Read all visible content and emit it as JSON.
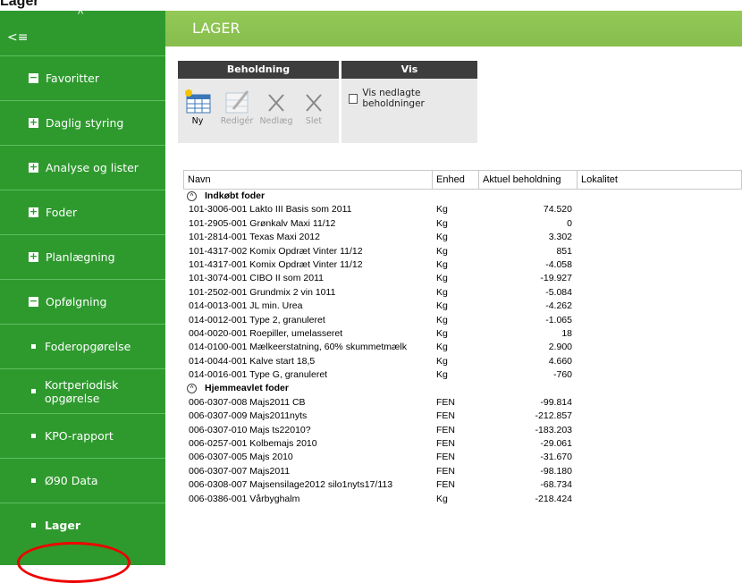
{
  "caption": "Lager",
  "sidebar": {
    "items": [
      {
        "label": "Favoritter",
        "kind": "box",
        "marker": "−"
      },
      {
        "label": "Daglig styring",
        "kind": "box",
        "marker": "+"
      },
      {
        "label": "Analyse og lister",
        "kind": "box",
        "marker": "+"
      },
      {
        "label": "Foder",
        "kind": "box",
        "marker": "+"
      },
      {
        "label": "Planlægning",
        "kind": "box",
        "marker": "+"
      },
      {
        "label": "Opfølgning",
        "kind": "box",
        "marker": "−"
      },
      {
        "label": "Foderopgørelse",
        "kind": "bullet"
      },
      {
        "label": "Kortperiodisk opgørelse",
        "kind": "bullet"
      },
      {
        "label": "KPO-rapport",
        "kind": "bullet"
      },
      {
        "label": "Ø90 Data",
        "kind": "bullet"
      },
      {
        "label": "Lager",
        "kind": "bullet",
        "bold": true
      }
    ]
  },
  "header": {
    "title": "LAGER"
  },
  "ribbon": {
    "beholdning": {
      "title": "Beholdning",
      "buttons": [
        {
          "label": "Ny",
          "icon": "new-table-icon",
          "enabled": true
        },
        {
          "label": "Redigér",
          "icon": "edit-icon",
          "enabled": false
        },
        {
          "label": "Nedlæg",
          "icon": "x-icon",
          "enabled": false
        },
        {
          "label": "Slet",
          "icon": "x-icon",
          "enabled": false
        }
      ]
    },
    "vis": {
      "title": "Vis",
      "checkbox_label": "Vis nedlagte beholdninger",
      "checked": false
    }
  },
  "table": {
    "columns": [
      "Navn",
      "Enhed",
      "Aktuel beholdning",
      "Lokalitet"
    ],
    "groups": [
      {
        "name": "Indkøbt foder",
        "rows": [
          [
            "101-3006-001 Lakto III Basis som 2011",
            "Kg",
            "74.520"
          ],
          [
            "101-2905-001 Grønkalv Maxi 11/12",
            "Kg",
            "0"
          ],
          [
            "101-2814-001 Texas Maxi 2012",
            "Kg",
            "3.302"
          ],
          [
            "101-4317-002 Komix Opdræt Vinter 11/12",
            "Kg",
            "851"
          ],
          [
            "101-4317-001 Komix Opdræt Vinter 11/12",
            "Kg",
            "-4.058"
          ],
          [
            "101-3074-001 CIBO II som 2011",
            "Kg",
            "-19.927"
          ],
          [
            "101-2502-001 Grundmix 2 vin 1011",
            "Kg",
            "-5.084"
          ],
          [
            "014-0013-001 JL min. Urea",
            "Kg",
            "-4.262"
          ],
          [
            "014-0012-001 Type 2, granuleret",
            "Kg",
            "-1.065"
          ],
          [
            "004-0020-001 Roepiller, umelasseret",
            "Kg",
            "18"
          ],
          [
            "014-0100-001 Mælkeerstatning, 60% skummetmælk",
            "Kg",
            "2.900"
          ],
          [
            "014-0044-001 Kalve start 18,5",
            "Kg",
            "4.660"
          ],
          [
            "014-0016-001 Type G, granuleret",
            "Kg",
            "-760"
          ]
        ]
      },
      {
        "name": "Hjemmeavlet foder",
        "rows": [
          [
            "006-0307-008 Majs2011 CB",
            "FEN",
            "-99.814"
          ],
          [
            "006-0307-009 Majs2011nyts",
            "FEN",
            "-212.857"
          ],
          [
            "006-0307-010 Majs ts22010?",
            "FEN",
            "-183.203"
          ],
          [
            "006-0257-001 Kolbemajs 2010",
            "FEN",
            "-29.061"
          ],
          [
            "006-0307-005 Majs 2010",
            "FEN",
            "-31.670"
          ],
          [
            "006-0307-007 Majs2011",
            "FEN",
            "-98.180"
          ],
          [
            "006-0308-007 Majsensilage2012 silo1nyts17/113",
            "FEN",
            "-68.734"
          ],
          [
            "006-0386-001 Vårbyghalm",
            "Kg",
            "-218.424"
          ]
        ]
      }
    ]
  }
}
